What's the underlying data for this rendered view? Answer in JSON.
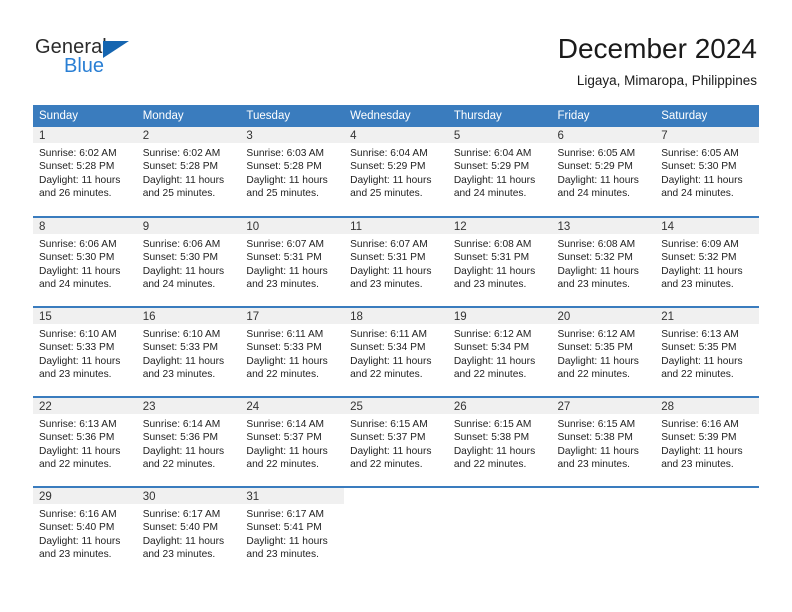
{
  "brand": {
    "name_top": "General",
    "name_bottom": "Blue",
    "triangle_color": "#1565b0",
    "blue_color": "#2a7fd4"
  },
  "header": {
    "month_title": "December 2024",
    "location": "Ligaya, Mimaropa, Philippines"
  },
  "accent_color": "#3a7cbe",
  "daynum_bg": "#f0f0f0",
  "weekdays": [
    "Sunday",
    "Monday",
    "Tuesday",
    "Wednesday",
    "Thursday",
    "Friday",
    "Saturday"
  ],
  "weeks": [
    [
      {
        "day": "1",
        "sunrise": "Sunrise: 6:02 AM",
        "sunset": "Sunset: 5:28 PM",
        "daylight": "Daylight: 11 hours and 26 minutes."
      },
      {
        "day": "2",
        "sunrise": "Sunrise: 6:02 AM",
        "sunset": "Sunset: 5:28 PM",
        "daylight": "Daylight: 11 hours and 25 minutes."
      },
      {
        "day": "3",
        "sunrise": "Sunrise: 6:03 AM",
        "sunset": "Sunset: 5:28 PM",
        "daylight": "Daylight: 11 hours and 25 minutes."
      },
      {
        "day": "4",
        "sunrise": "Sunrise: 6:04 AM",
        "sunset": "Sunset: 5:29 PM",
        "daylight": "Daylight: 11 hours and 25 minutes."
      },
      {
        "day": "5",
        "sunrise": "Sunrise: 6:04 AM",
        "sunset": "Sunset: 5:29 PM",
        "daylight": "Daylight: 11 hours and 24 minutes."
      },
      {
        "day": "6",
        "sunrise": "Sunrise: 6:05 AM",
        "sunset": "Sunset: 5:29 PM",
        "daylight": "Daylight: 11 hours and 24 minutes."
      },
      {
        "day": "7",
        "sunrise": "Sunrise: 6:05 AM",
        "sunset": "Sunset: 5:30 PM",
        "daylight": "Daylight: 11 hours and 24 minutes."
      }
    ],
    [
      {
        "day": "8",
        "sunrise": "Sunrise: 6:06 AM",
        "sunset": "Sunset: 5:30 PM",
        "daylight": "Daylight: 11 hours and 24 minutes."
      },
      {
        "day": "9",
        "sunrise": "Sunrise: 6:06 AM",
        "sunset": "Sunset: 5:30 PM",
        "daylight": "Daylight: 11 hours and 24 minutes."
      },
      {
        "day": "10",
        "sunrise": "Sunrise: 6:07 AM",
        "sunset": "Sunset: 5:31 PM",
        "daylight": "Daylight: 11 hours and 23 minutes."
      },
      {
        "day": "11",
        "sunrise": "Sunrise: 6:07 AM",
        "sunset": "Sunset: 5:31 PM",
        "daylight": "Daylight: 11 hours and 23 minutes."
      },
      {
        "day": "12",
        "sunrise": "Sunrise: 6:08 AM",
        "sunset": "Sunset: 5:31 PM",
        "daylight": "Daylight: 11 hours and 23 minutes."
      },
      {
        "day": "13",
        "sunrise": "Sunrise: 6:08 AM",
        "sunset": "Sunset: 5:32 PM",
        "daylight": "Daylight: 11 hours and 23 minutes."
      },
      {
        "day": "14",
        "sunrise": "Sunrise: 6:09 AM",
        "sunset": "Sunset: 5:32 PM",
        "daylight": "Daylight: 11 hours and 23 minutes."
      }
    ],
    [
      {
        "day": "15",
        "sunrise": "Sunrise: 6:10 AM",
        "sunset": "Sunset: 5:33 PM",
        "daylight": "Daylight: 11 hours and 23 minutes."
      },
      {
        "day": "16",
        "sunrise": "Sunrise: 6:10 AM",
        "sunset": "Sunset: 5:33 PM",
        "daylight": "Daylight: 11 hours and 23 minutes."
      },
      {
        "day": "17",
        "sunrise": "Sunrise: 6:11 AM",
        "sunset": "Sunset: 5:33 PM",
        "daylight": "Daylight: 11 hours and 22 minutes."
      },
      {
        "day": "18",
        "sunrise": "Sunrise: 6:11 AM",
        "sunset": "Sunset: 5:34 PM",
        "daylight": "Daylight: 11 hours and 22 minutes."
      },
      {
        "day": "19",
        "sunrise": "Sunrise: 6:12 AM",
        "sunset": "Sunset: 5:34 PM",
        "daylight": "Daylight: 11 hours and 22 minutes."
      },
      {
        "day": "20",
        "sunrise": "Sunrise: 6:12 AM",
        "sunset": "Sunset: 5:35 PM",
        "daylight": "Daylight: 11 hours and 22 minutes."
      },
      {
        "day": "21",
        "sunrise": "Sunrise: 6:13 AM",
        "sunset": "Sunset: 5:35 PM",
        "daylight": "Daylight: 11 hours and 22 minutes."
      }
    ],
    [
      {
        "day": "22",
        "sunrise": "Sunrise: 6:13 AM",
        "sunset": "Sunset: 5:36 PM",
        "daylight": "Daylight: 11 hours and 22 minutes."
      },
      {
        "day": "23",
        "sunrise": "Sunrise: 6:14 AM",
        "sunset": "Sunset: 5:36 PM",
        "daylight": "Daylight: 11 hours and 22 minutes."
      },
      {
        "day": "24",
        "sunrise": "Sunrise: 6:14 AM",
        "sunset": "Sunset: 5:37 PM",
        "daylight": "Daylight: 11 hours and 22 minutes."
      },
      {
        "day": "25",
        "sunrise": "Sunrise: 6:15 AM",
        "sunset": "Sunset: 5:37 PM",
        "daylight": "Daylight: 11 hours and 22 minutes."
      },
      {
        "day": "26",
        "sunrise": "Sunrise: 6:15 AM",
        "sunset": "Sunset: 5:38 PM",
        "daylight": "Daylight: 11 hours and 22 minutes."
      },
      {
        "day": "27",
        "sunrise": "Sunrise: 6:15 AM",
        "sunset": "Sunset: 5:38 PM",
        "daylight": "Daylight: 11 hours and 23 minutes."
      },
      {
        "day": "28",
        "sunrise": "Sunrise: 6:16 AM",
        "sunset": "Sunset: 5:39 PM",
        "daylight": "Daylight: 11 hours and 23 minutes."
      }
    ],
    [
      {
        "day": "29",
        "sunrise": "Sunrise: 6:16 AM",
        "sunset": "Sunset: 5:40 PM",
        "daylight": "Daylight: 11 hours and 23 minutes."
      },
      {
        "day": "30",
        "sunrise": "Sunrise: 6:17 AM",
        "sunset": "Sunset: 5:40 PM",
        "daylight": "Daylight: 11 hours and 23 minutes."
      },
      {
        "day": "31",
        "sunrise": "Sunrise: 6:17 AM",
        "sunset": "Sunset: 5:41 PM",
        "daylight": "Daylight: 11 hours and 23 minutes."
      },
      {
        "day": "",
        "sunrise": "",
        "sunset": "",
        "daylight": ""
      },
      {
        "day": "",
        "sunrise": "",
        "sunset": "",
        "daylight": ""
      },
      {
        "day": "",
        "sunrise": "",
        "sunset": "",
        "daylight": ""
      },
      {
        "day": "",
        "sunrise": "",
        "sunset": "",
        "daylight": ""
      }
    ]
  ]
}
